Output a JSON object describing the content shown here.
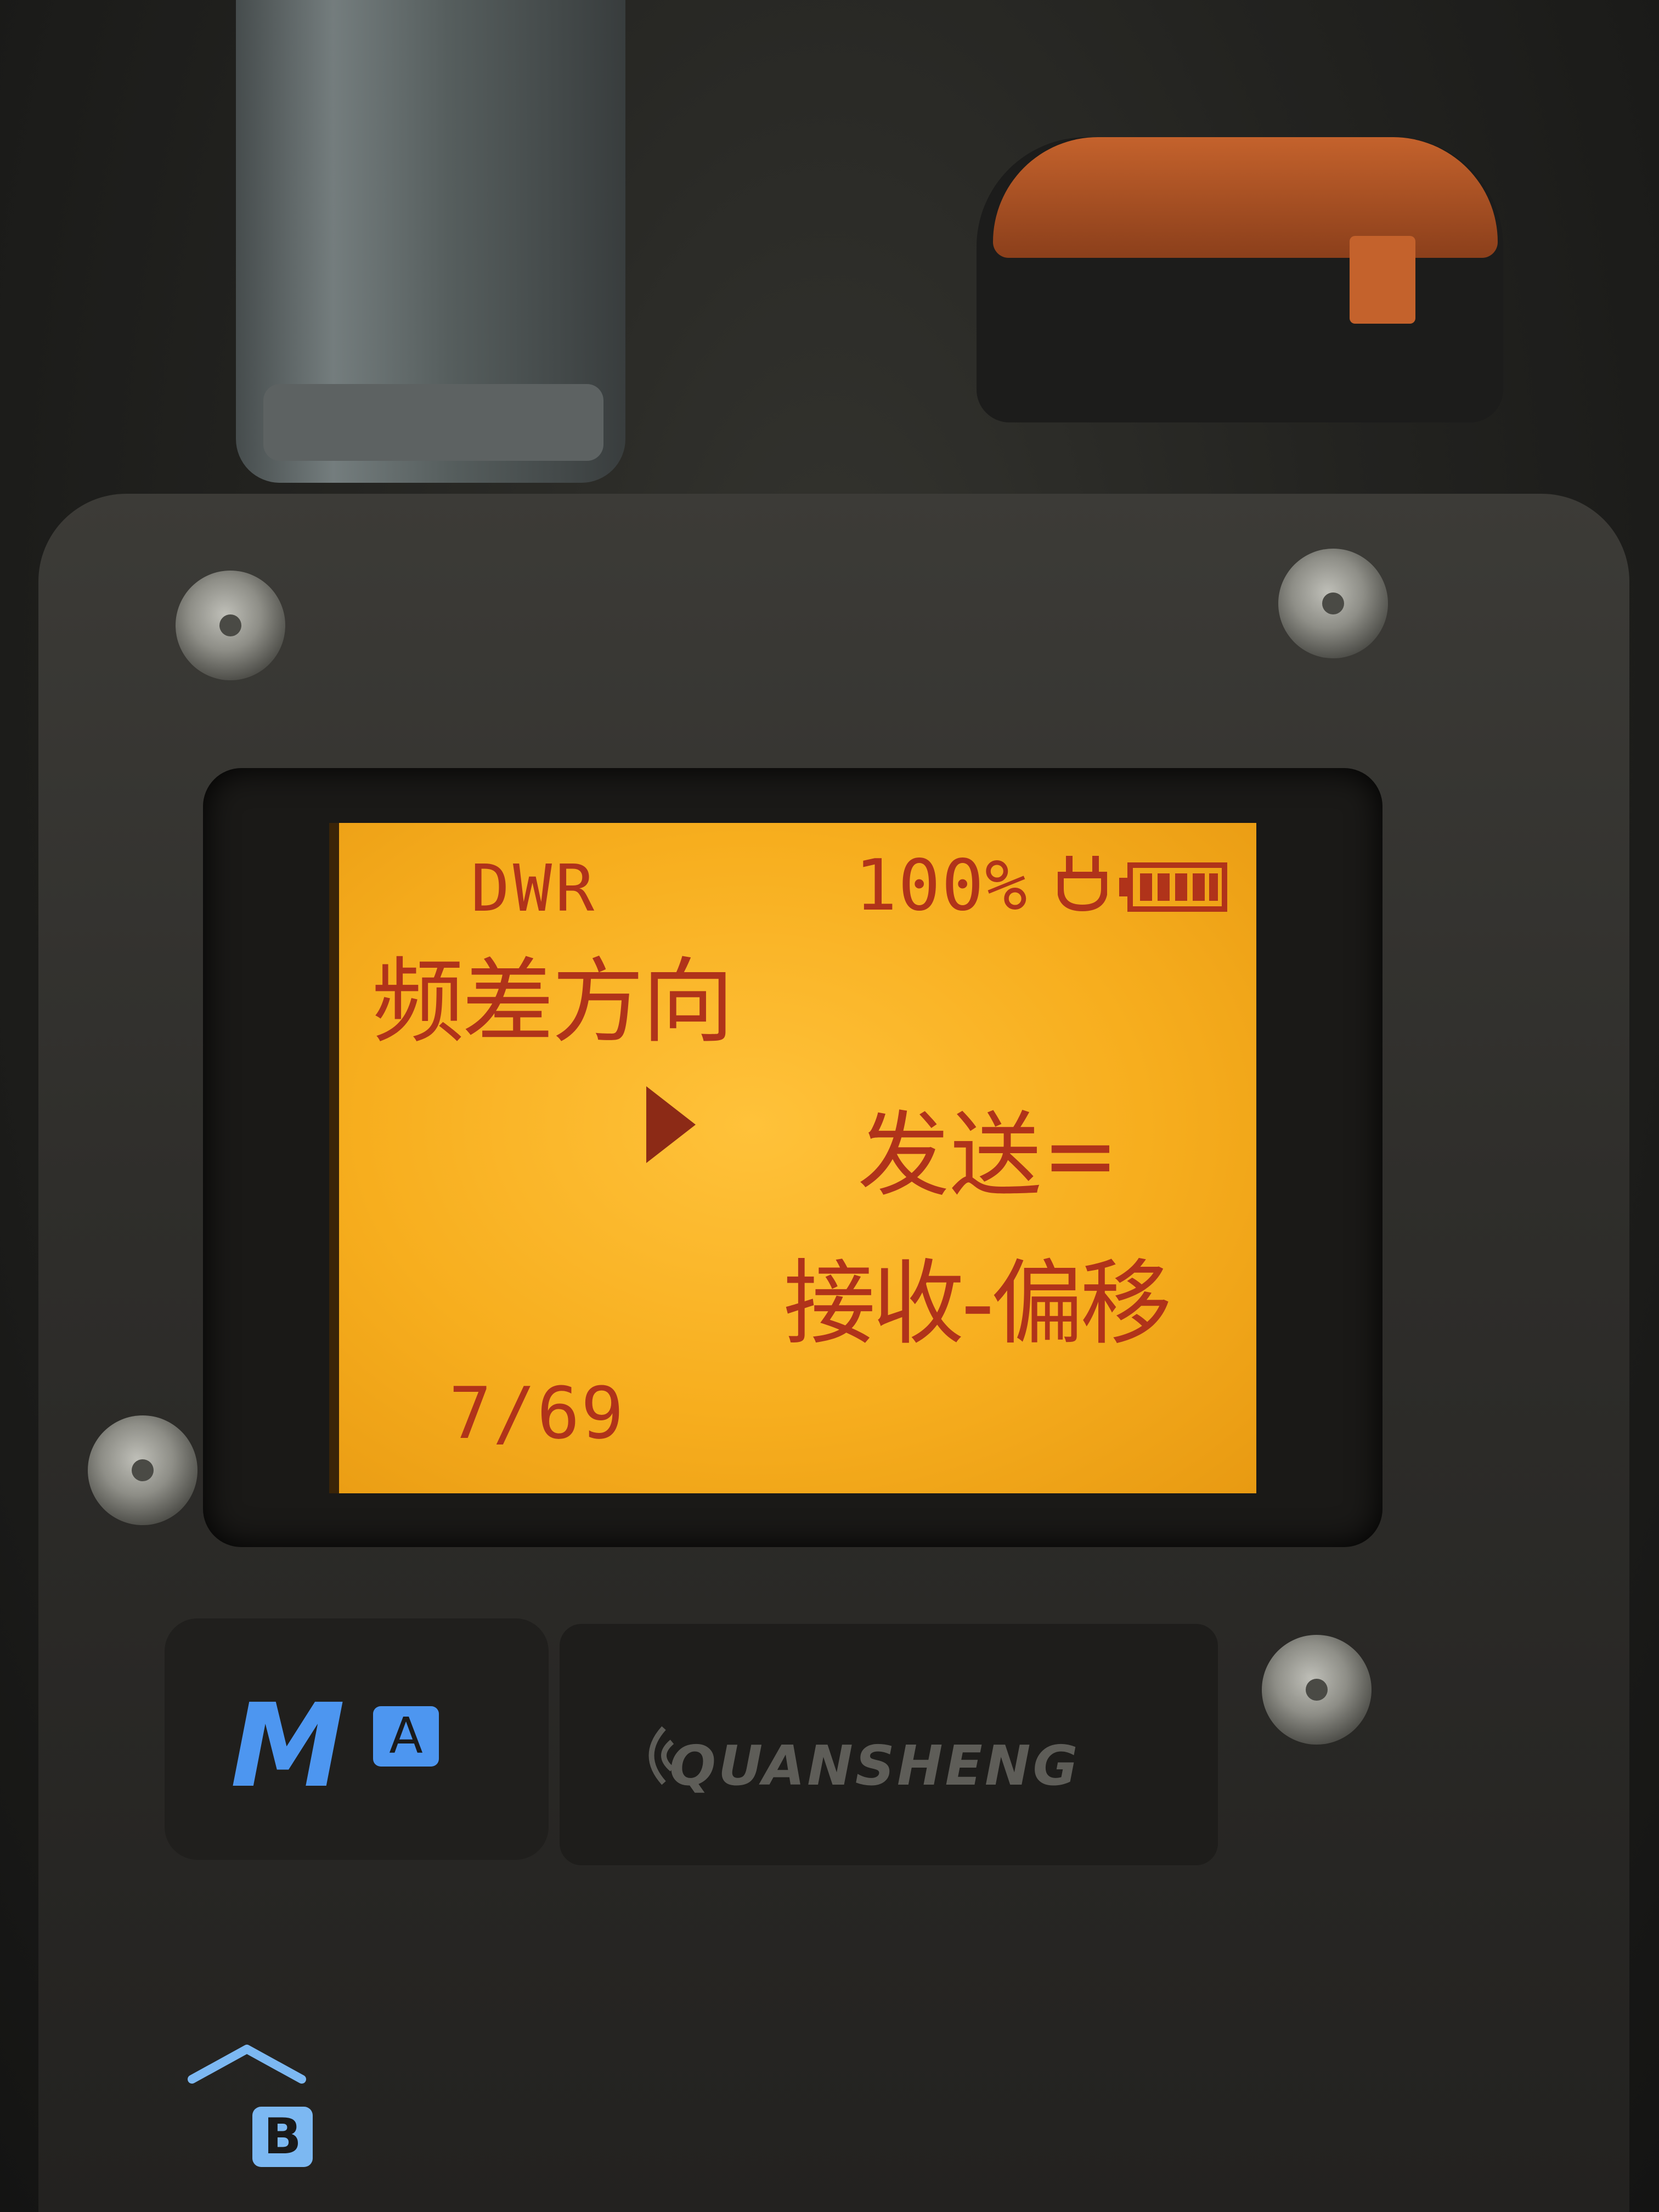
{
  "display": {
    "mode": "DWR",
    "battery_percent": "100%",
    "menu_title": "频差方向",
    "option_selected": "发送=",
    "option_next": "接收-偏移",
    "page_indicator": "7/69"
  },
  "keys": {
    "m_key": "M",
    "a_key": "A",
    "b_key": "B",
    "up_icon": "chevron-up-icon"
  },
  "brand": {
    "name": "QUANSHENG"
  },
  "colors": {
    "lcd_background": "#f7ae1e",
    "lcd_text": "#b0331a",
    "key_accent": "#4d96f0"
  }
}
